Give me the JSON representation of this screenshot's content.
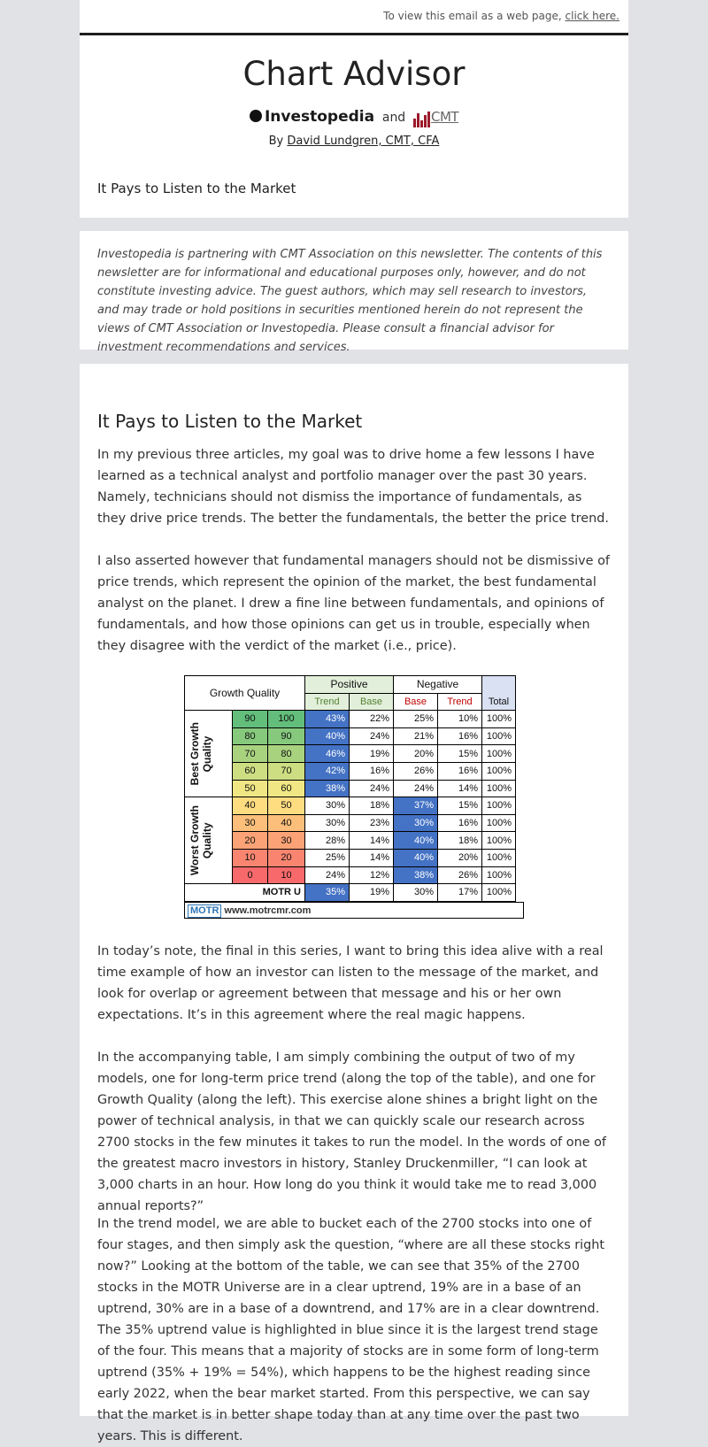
{
  "topbar": {
    "text": "To view this email as a web page,",
    "link": "click here."
  },
  "header": {
    "title": "Chart Advisor",
    "investopedia": "Investopedia",
    "and": "and",
    "cmt": "CMT",
    "by": "By",
    "author": "David Lundgren, CMT, CFA",
    "subtitle": "It Pays to Listen to the Market"
  },
  "disclaimer": "Investopedia is partnering with CMT Association on this newsletter.  The contents of this newsletter are for informational and educational purposes only, however, and do not constitute investing advice. The guest authors, which may sell research to investors, and may trade or hold positions in securities mentioned herein do not represent the views of CMT Association or Investopedia. Please consult a financial advisor for investment recommendations and services.",
  "article": {
    "title": "It Pays to Listen to the Market",
    "p1": "In my previous three articles, my goal was to drive home a few lessons I have learned as a technical analyst and portfolio manager over the past 30 years. Namely, technicians should not dismiss the importance of fundamentals, as they drive price trends. The better the fundamentals, the better the price trend.",
    "p2": "I also asserted however that fundamental managers should not be dismissive of price trends, which represent the opinion of the market, the best fundamental analyst on the planet. I drew a fine line between fundamentals, and opinions of fundamentals, and how those opinions can get us in trouble, especially when they disagree with the verdict of the market (i.e., price).",
    "p3": "In today’s note, the final in this series, I want to bring this idea alive with a real time example of how an investor can listen to the message of the market, and look for overlap or agreement between that message and his or her own expectations. It’s in this agreement where the real magic happens.",
    "p4": "In the accompanying table, I am simply combining the output of two of my models, one for long-term price trend (along the top of the table), and one for Growth Quality (along the left). This exercise alone shines a bright light on the power of technical analysis, in that we can quickly scale our research across 2700 stocks in the few minutes it takes to run the model. In the words of one of the greatest macro investors in history, Stanley Druckenmiller, “I can look at 3,000 charts in an hour. How long do you think it would take me to read 3,000 annual reports?”",
    "p5": "In the trend model, we are able to bucket each of the 2700 stocks into one of four stages, and then simply ask the question, “where are all these stocks right now?” Looking at the bottom of the table, we can see that 35% of the 2700 stocks in the MOTR Universe are in a clear uptrend, 19% are in a base of an uptrend, 30% are in a base of a downtrend, and 17% are in a clear downtrend. The 35% uptrend value is highlighted in blue since it is the largest trend stage of the four. This means that a majority of stocks are in some form of long-term uptrend (35% + 19% = 54%), which happens to be the highest reading since early 2022, when the bear market started. From this perspective, we can say that the market is in better shape today than at any time over the past two years. This is different."
  },
  "table": {
    "growth_quality": "Growth Quality",
    "positive": "Positive",
    "negative": "Negative",
    "trend": "Trend",
    "base": "Base",
    "total": "Total",
    "best_growth": "Best Growth\nQuality",
    "worst_growth": "Worst Growth\nQuality",
    "motr_u": "MOTR U",
    "logo": "MOTR",
    "url": "www.motrcmr.com",
    "rows": [
      {
        "lo": "90",
        "hi": "100",
        "pt": "43%",
        "pb": "22%",
        "nb": "25%",
        "nt": "10%",
        "tot": "100%"
      },
      {
        "lo": "80",
        "hi": "90",
        "pt": "40%",
        "pb": "24%",
        "nb": "21%",
        "nt": "16%",
        "tot": "100%"
      },
      {
        "lo": "70",
        "hi": "80",
        "pt": "46%",
        "pb": "19%",
        "nb": "20%",
        "nt": "15%",
        "tot": "100%"
      },
      {
        "lo": "60",
        "hi": "70",
        "pt": "42%",
        "pb": "16%",
        "nb": "26%",
        "nt": "16%",
        "tot": "100%"
      },
      {
        "lo": "50",
        "hi": "60",
        "pt": "38%",
        "pb": "24%",
        "nb": "24%",
        "nt": "14%",
        "tot": "100%"
      },
      {
        "lo": "40",
        "hi": "50",
        "pt": "30%",
        "pb": "18%",
        "nb": "37%",
        "nt": "15%",
        "tot": "100%"
      },
      {
        "lo": "30",
        "hi": "40",
        "pt": "30%",
        "pb": "23%",
        "nb": "30%",
        "nt": "16%",
        "tot": "100%"
      },
      {
        "lo": "20",
        "hi": "30",
        "pt": "28%",
        "pb": "14%",
        "nb": "40%",
        "nt": "18%",
        "tot": "100%"
      },
      {
        "lo": "10",
        "hi": "20",
        "pt": "25%",
        "pb": "14%",
        "nb": "40%",
        "nt": "20%",
        "tot": "100%"
      },
      {
        "lo": "0",
        "hi": "10",
        "pt": "24%",
        "pb": "12%",
        "nb": "38%",
        "nt": "26%",
        "tot": "100%"
      }
    ],
    "summary": {
      "pt": "35%",
      "pb": "19%",
      "nb": "30%",
      "nt": "17%",
      "tot": "100%"
    }
  }
}
